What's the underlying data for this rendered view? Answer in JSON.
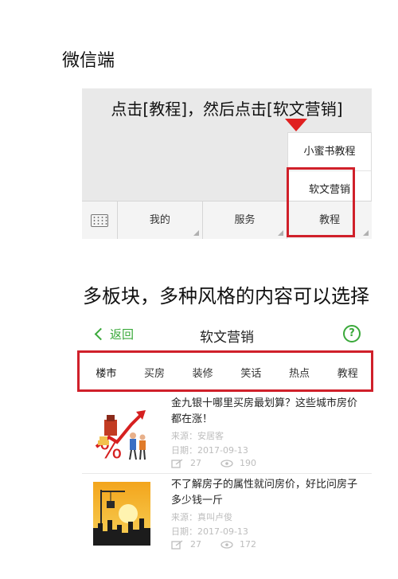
{
  "heading_wechat": "微信端",
  "heading_sections": "多板块，多种风格的内容可以选择",
  "panel1": {
    "caption": "点击[教程]，然后点击[软文营销]",
    "popup_items": [
      "小蜜书教程",
      "软文营销"
    ],
    "menu_items": [
      "我的",
      "服务",
      "教程"
    ]
  },
  "panel2": {
    "back_label": "返回",
    "title": "软文营销",
    "help_glyph": "?",
    "tabs": [
      "楼市",
      "买房",
      "装修",
      "笑话",
      "热点",
      "教程"
    ],
    "active_tab": "楼市",
    "articles": [
      {
        "title": "金九银十哪里买房最划算？这些城市房价都在涨！",
        "source": "来源：安居客",
        "date": "日期：2017-09-13",
        "shares": "27",
        "views": "190"
      },
      {
        "title": "不了解房子的属性就问房价，好比问房子多少钱一斤",
        "source": "来源：真叫卢俊",
        "date": "日期：2017-09-13",
        "shares": "27",
        "views": "172"
      }
    ]
  },
  "colors": {
    "accent_green": "#3aa93a",
    "highlight_red": "#d0202a",
    "arrow_red": "#e02020"
  }
}
